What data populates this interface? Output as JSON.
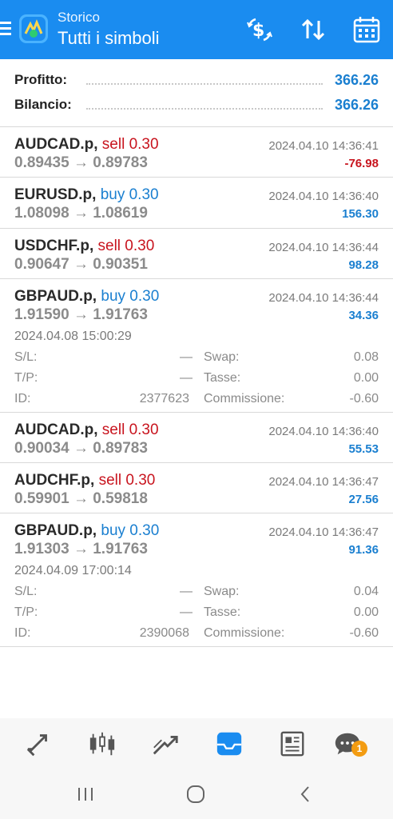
{
  "header": {
    "subtitle": "Storico",
    "title": "Tutti i simboli",
    "colors": {
      "bar": "#1a8cf0"
    }
  },
  "summary": {
    "profit_label": "Profitto:",
    "profit_value": "366.26",
    "balance_label": "Bilancio:",
    "balance_value": "366.26"
  },
  "deals": [
    {
      "symbol": "AUDCAD.p,",
      "side": "sell 0.30",
      "prices": "0.89435 → 0.89783",
      "time": "2024.04.10 14:36:41",
      "profit": "-76.98"
    },
    {
      "symbol": "EURUSD.p,",
      "side": "buy 0.30",
      "prices": "1.08098 → 1.08619",
      "time": "2024.04.10 14:36:40",
      "profit": "156.30"
    },
    {
      "symbol": "USDCHF.p,",
      "side": "sell 0.30",
      "prices": "0.90647 → 0.90351",
      "time": "2024.04.10 14:36:44",
      "profit": "98.28"
    },
    {
      "symbol": "GBPAUD.p,",
      "side": "buy 0.30",
      "prices": "1.91590 → 1.91763",
      "time": "2024.04.10 14:36:44",
      "profit": "34.36",
      "details": {
        "open_time": "2024.04.08 15:00:29",
        "sl_label": "S/L:",
        "sl": "—",
        "tp_label": "T/P:",
        "tp": "—",
        "id_label": "ID:",
        "id": "2377623",
        "swap_label": "Swap:",
        "swap": "0.08",
        "tax_label": "Tasse:",
        "tax": "0.00",
        "comm_label": "Commissione:",
        "comm": "-0.60"
      }
    },
    {
      "symbol": "AUDCAD.p,",
      "side": "sell 0.30",
      "prices": "0.90034 → 0.89783",
      "time": "2024.04.10 14:36:40",
      "profit": "55.53"
    },
    {
      "symbol": "AUDCHF.p,",
      "side": "sell 0.30",
      "prices": "0.59901 → 0.59818",
      "time": "2024.04.10 14:36:47",
      "profit": "27.56"
    },
    {
      "symbol": "GBPAUD.p,",
      "side": "buy 0.30",
      "prices": "1.91303 → 1.91763",
      "time": "2024.04.10 14:36:47",
      "profit": "91.36",
      "details": {
        "open_time": "2024.04.09 17:00:14",
        "sl_label": "S/L:",
        "sl": "—",
        "tp_label": "T/P:",
        "tp": "—",
        "id_label": "ID:",
        "id": "2390068",
        "swap_label": "Swap:",
        "swap": "0.04",
        "tax_label": "Tasse:",
        "tax": "0.00",
        "comm_label": "Commissione:",
        "comm": "-0.60"
      }
    }
  ],
  "bottom_nav": {
    "icons": [
      "quotes-icon",
      "chart-candles-icon",
      "trade-icon",
      "history-inbox-icon",
      "news-icon",
      "chat-icon"
    ],
    "chat_badge": "1"
  }
}
